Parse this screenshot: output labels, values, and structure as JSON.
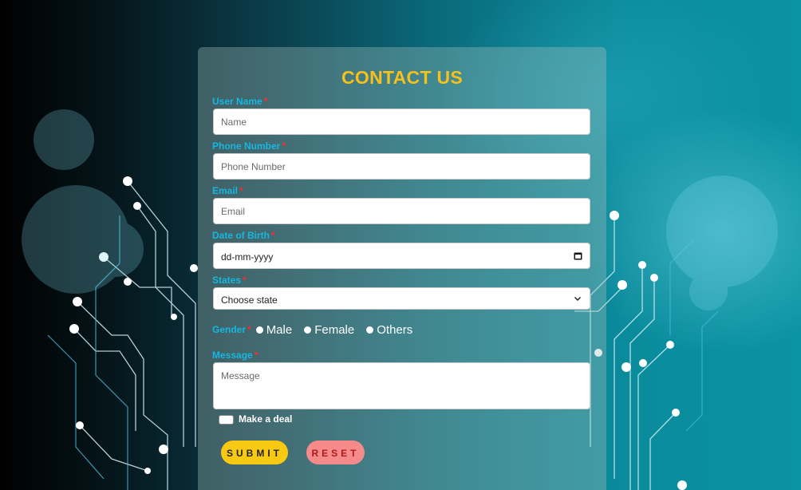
{
  "form": {
    "title": "CONTACT US",
    "required_mark": "*",
    "fields": {
      "username": {
        "label": "User Name",
        "placeholder": "Name"
      },
      "phone": {
        "label": "Phone Number",
        "placeholder": "Phone Number"
      },
      "email": {
        "label": "Email",
        "placeholder": "Email"
      },
      "dob": {
        "label": "Date of Birth",
        "value": "dd-mm-yyyy"
      },
      "state": {
        "label": "States",
        "selected": "Choose state"
      },
      "gender": {
        "label": "Gender",
        "options": [
          "Male",
          "Female",
          "Others"
        ]
      },
      "message": {
        "label": "Message",
        "placeholder": "Message"
      }
    },
    "checkbox_label": "Make a deal",
    "submit_label": "SUBMIT",
    "reset_label": "RESET"
  },
  "colors": {
    "title": "#f6c11a",
    "label": "#16b7e0",
    "required": "#ff2a2a",
    "submit_bg": "#f8c913",
    "reset_bg": "#f48a8a",
    "reset_text": "#b21a1a"
  },
  "icons": {
    "date": "calendar-icon",
    "select": "chevron-down-icon"
  }
}
